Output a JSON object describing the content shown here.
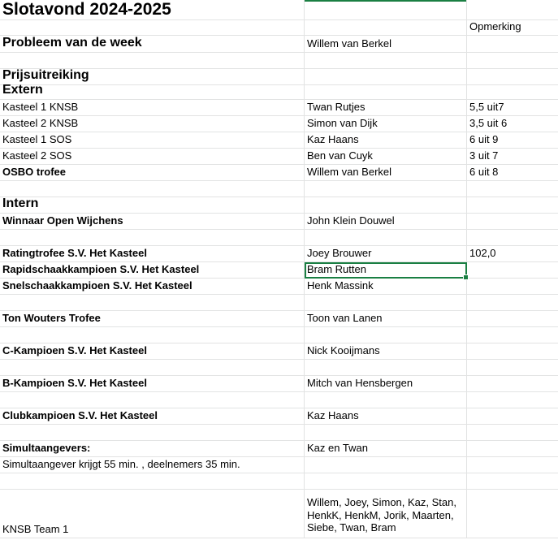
{
  "rows": [
    {
      "h": 25,
      "a": "Slotavond 2024-2025",
      "aStyle": "h1",
      "b": "",
      "c": ""
    },
    {
      "h": 19,
      "a": "",
      "b": "",
      "c": "Opmerking"
    },
    {
      "h": 21,
      "a": "Probleem van de week",
      "aStyle": "h2",
      "b": "Willem van Berkel",
      "c": ""
    },
    {
      "h": 20,
      "a": "",
      "b": "",
      "c": ""
    },
    {
      "h": 20,
      "a": "Prijsuitreiking",
      "aStyle": "h2",
      "b": "",
      "c": ""
    },
    {
      "h": 18,
      "a": "Extern",
      "aStyle": "h2",
      "b": "",
      "c": ""
    },
    {
      "h": 20,
      "a": "Kasteel 1 KNSB",
      "b": "Twan Rutjes",
      "c": "5,5 uit7"
    },
    {
      "h": 20,
      "a": "Kasteel 2 KNSB",
      "b": "Simon van Dijk",
      "c": "3,5 uit 6"
    },
    {
      "h": 20,
      "a": "Kasteel 1 SOS",
      "b": "Kaz Haans",
      "c": "6 uit 9"
    },
    {
      "h": 20,
      "a": "Kasteel 2 SOS",
      "b": "Ben  van Cuyk",
      "c": "3 uit 7"
    },
    {
      "h": 20,
      "a": "OSBO trofee",
      "aStyle": "bold",
      "b": "Willem van Berkel",
      "c": "6 uit 8"
    },
    {
      "h": 20,
      "a": "",
      "b": "",
      "c": ""
    },
    {
      "h": 20,
      "a": "Intern",
      "aStyle": "h2",
      "b": "",
      "c": ""
    },
    {
      "h": 20,
      "a": "Winnaar Open Wijchens",
      "aStyle": "bold",
      "b": "John Klein Douwel",
      "c": ""
    },
    {
      "h": 20,
      "a": "",
      "b": "",
      "c": ""
    },
    {
      "h": 20,
      "a": "Ratingtrofee S.V. Het Kasteel",
      "aStyle": "bold",
      "b": "Joey Brouwer",
      "c": "102,0"
    },
    {
      "h": 20,
      "a": "Rapidschaakkampioen S.V. Het Kasteel",
      "aStyle": "bold",
      "b": "Bram Rutten",
      "c": "",
      "selected": true
    },
    {
      "h": 20,
      "a": "Snelschaakkampioen S.V. Het Kasteel",
      "aStyle": "bold",
      "b": "Henk Massink",
      "c": ""
    },
    {
      "h": 20,
      "a": "",
      "b": "",
      "c": ""
    },
    {
      "h": 20,
      "a": "Ton Wouters Trofee",
      "aStyle": "bold",
      "b": "Toon van Lanen",
      "c": ""
    },
    {
      "h": 20,
      "a": "",
      "b": "",
      "c": ""
    },
    {
      "h": 20,
      "a": "C-Kampioen S.V. Het Kasteel",
      "aStyle": "bold",
      "b": "Nick Kooijmans",
      "c": ""
    },
    {
      "h": 20,
      "a": "",
      "b": "",
      "c": ""
    },
    {
      "h": 20,
      "a": "B-Kampioen S.V. Het Kasteel",
      "aStyle": "bold",
      "b": "Mitch van Hensbergen",
      "c": ""
    },
    {
      "h": 20,
      "a": "",
      "b": "",
      "c": ""
    },
    {
      "h": 20,
      "a": "Clubkampioen S.V. Het Kasteel",
      "aStyle": "bold",
      "b": "Kaz Haans",
      "c": ""
    },
    {
      "h": 20,
      "a": "",
      "b": "",
      "c": ""
    },
    {
      "h": 20,
      "a": "Simultaangevers:",
      "aStyle": "bold",
      "b": "Kaz en Twan",
      "c": ""
    },
    {
      "h": 20,
      "a": "Simultaangever krijgt 55 min. , deelnemers 35 min.",
      "b": "",
      "c": ""
    },
    {
      "h": 20,
      "a": "",
      "b": "",
      "c": ""
    },
    {
      "h": 60,
      "a": "KNSB Team 1",
      "b": "Willem, Joey, Simon, Kaz, Stan, HenkK, HenkM, Jorik, Maarten, Siebe, Twan, Bram",
      "bWrap": true,
      "c": ""
    }
  ]
}
